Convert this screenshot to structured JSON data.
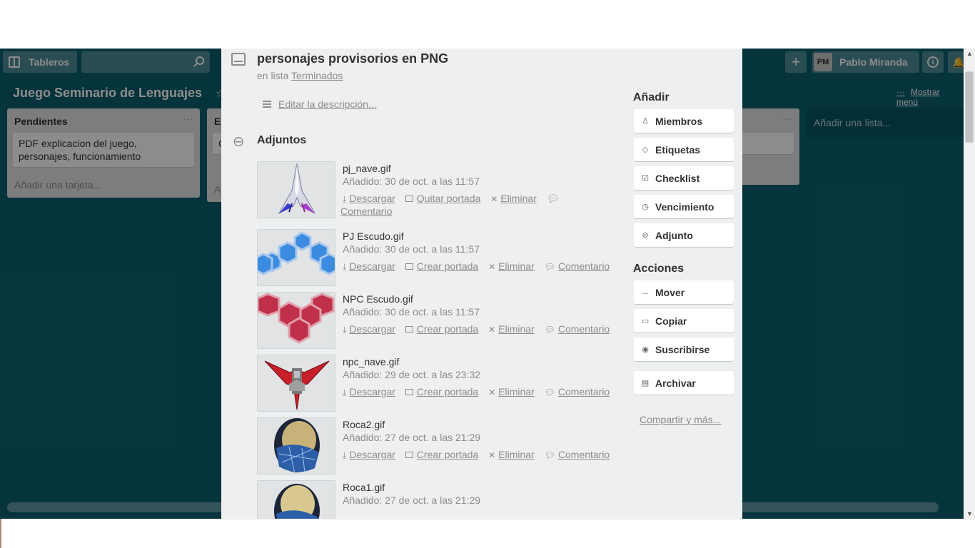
{
  "topbar": {
    "boards_label": "Tableros",
    "user_initials": "PM",
    "user_name": "Pablo Miranda",
    "add_symbol": "+",
    "info_symbol": "i"
  },
  "board": {
    "title": "Juego Seminario de Lenguajes",
    "show_menu": "Mostrar menú",
    "lists": [
      {
        "name": "Pendientes",
        "card": "PDF explicacion del juego, personajes, funcionamiento",
        "add_card": "Añadir una tarjeta..."
      },
      {
        "name": "E",
        "card": "C",
        "add_card": "A"
      }
    ],
    "add_list": "Añadir una lista..."
  },
  "card": {
    "title": "personajes provisorios en PNG",
    "in_list_prefix": "en lista",
    "list_name": "Terminados",
    "edit_description": "Editar la descripción...",
    "attachments_title": "Adjuntos",
    "attachments": [
      {
        "name": "pj_nave.gif",
        "date": "Añadido: 30 de oct. a las 11:57",
        "cover_action": "Quitar portada"
      },
      {
        "name": "PJ Escudo.gif",
        "date": "Añadido: 30 de oct. a las 11:57",
        "cover_action": "Crear portada"
      },
      {
        "name": "NPC Escudo.gif",
        "date": "Añadido: 30 de oct. a las 11:57",
        "cover_action": "Crear portada"
      },
      {
        "name": "npc_nave.gif",
        "date": "Añadido: 29 de oct. a las 23:32",
        "cover_action": "Crear portada"
      },
      {
        "name": "Roca2.gif",
        "date": "Añadido: 27 de oct. a las 21:29",
        "cover_action": "Crear portada"
      },
      {
        "name": "Roca1.gif",
        "date": "Añadido: 27 de oct. a las 21:29",
        "cover_action": "Crear portada"
      }
    ],
    "actions": {
      "download": "Descargar",
      "delete": "Eliminar",
      "comment": "Comentario"
    }
  },
  "sidebar": {
    "add_heading": "Añadir",
    "add_buttons": [
      "Miembros",
      "Etiquetas",
      "Checklist",
      "Vencimiento",
      "Adjunto"
    ],
    "actions_heading": "Acciones",
    "action_buttons": [
      "Mover",
      "Copiar",
      "Suscribirse"
    ],
    "archive": "Archivar",
    "share_more": "Compartir y más..."
  },
  "colors": {
    "board_bg": "#0b606f",
    "modal_bg": "#edeff0",
    "pj_shield": "#3b8be0",
    "npc_shield": "#c0304a"
  }
}
